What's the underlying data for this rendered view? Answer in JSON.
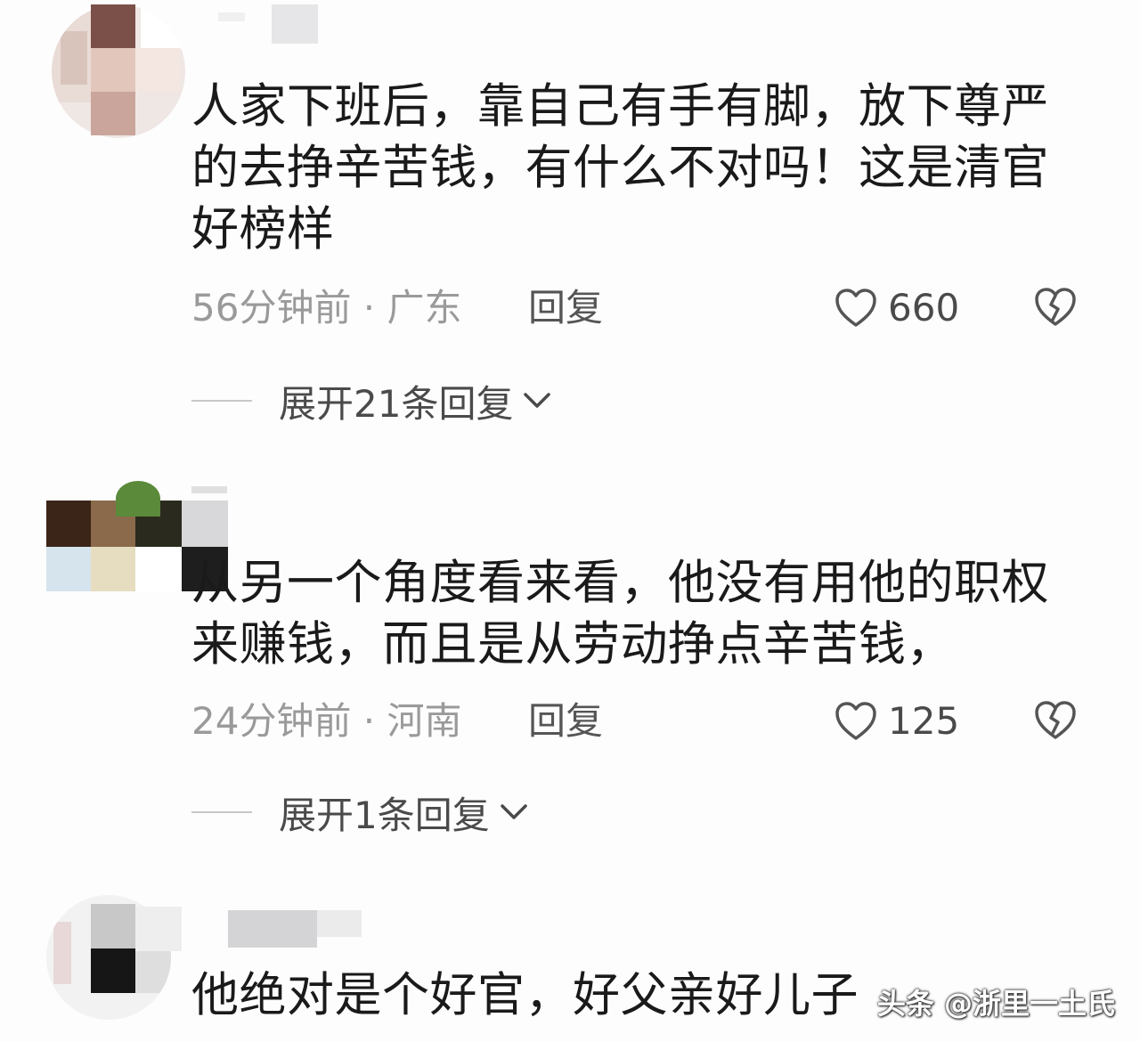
{
  "comments": [
    {
      "text": "人家下班后，靠自己有手有脚，放下尊严的去挣辛苦钱，有什么不对吗！这是清官好榜样",
      "time_location": "56分钟前 · 广东",
      "reply_label": "回复",
      "likes": "660",
      "expand_label": "展开21条回复"
    },
    {
      "text": "从另一个角度看来看，他没有用他的职权来赚钱，而且是从劳动挣点辛苦钱，",
      "time_location": "24分钟前 · 河南",
      "reply_label": "回复",
      "likes": "125",
      "expand_label": "展开1条回复"
    },
    {
      "text": "他绝对是个好官，好父亲好儿子"
    }
  ],
  "watermark": "头条 @浙里一土氏",
  "colors": {
    "text": "#1a1a1a",
    "meta": "#9a9a9a",
    "icon": "#555555"
  },
  "icons": {
    "like": "heart-outline-icon",
    "dislike": "broken-heart-icon",
    "expand": "chevron-down-icon"
  }
}
